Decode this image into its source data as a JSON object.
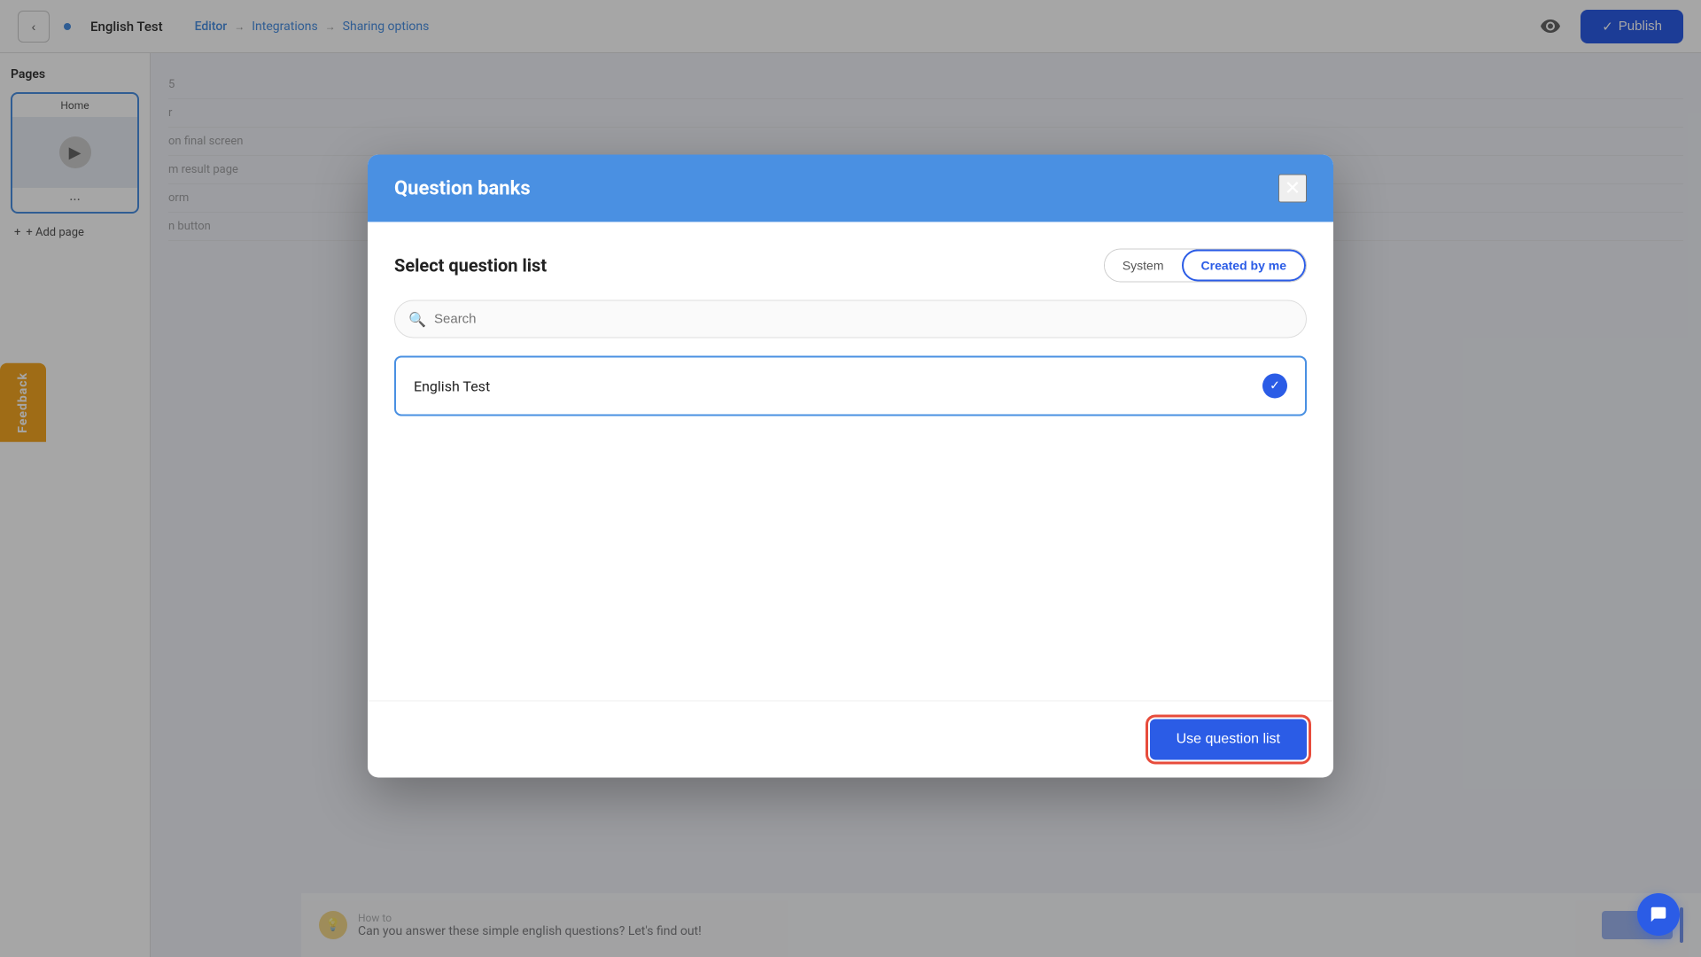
{
  "nav": {
    "back_label": "‹",
    "title_dot": "",
    "title": "English Test",
    "steps": [
      "Editor",
      "Integrations",
      "Sharing options"
    ],
    "arrows": [
      "→",
      "→"
    ],
    "eye_icon": "👁",
    "publish_check": "✓",
    "publish_label": "Publish"
  },
  "sidebar": {
    "title": "Pages",
    "page_label": "Home",
    "add_page_label": "+ Add page"
  },
  "right_panel": {
    "items": [
      "5",
      "r",
      "on final screen",
      "m result page",
      "orm",
      "n button"
    ]
  },
  "feedback": {
    "label": "Feedback"
  },
  "modal": {
    "title": "Question banks",
    "close_icon": "✕",
    "select_title": "Select question list",
    "tabs": [
      {
        "label": "System",
        "active": false
      },
      {
        "label": "Created by me",
        "active": true
      }
    ],
    "search_placeholder": "Search",
    "search_icon": "🔍",
    "question_items": [
      {
        "label": "English Test",
        "selected": true
      }
    ],
    "check_icon": "✓",
    "use_button_label": "Use question list"
  },
  "bottom": {
    "icon": "💡",
    "label": "How to",
    "text": "Can you answer these simple english questions? Let's find out!"
  },
  "chat": {
    "icon": "💬"
  }
}
